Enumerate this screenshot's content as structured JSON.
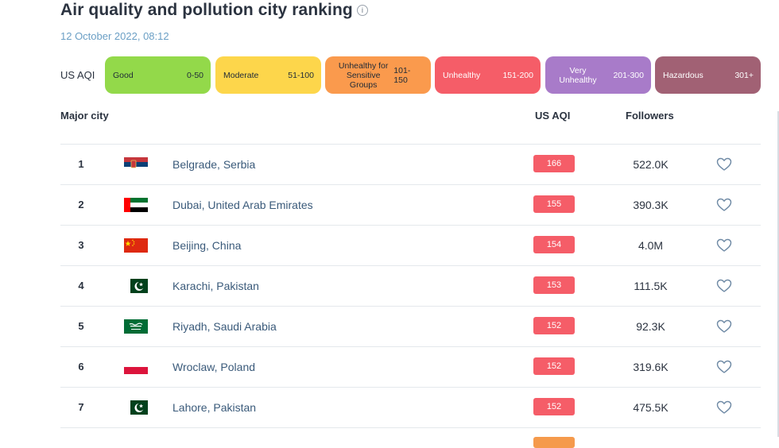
{
  "header": {
    "title": "Air quality and pollution city ranking",
    "info_icon": "info-icon",
    "info_glyph": "i",
    "timestamp": "12 October 2022, 08:12"
  },
  "legend": {
    "label": "US AQI",
    "items": [
      {
        "category": "Good",
        "range": "0-50",
        "color": "#93d94a"
      },
      {
        "category": "Moderate",
        "range": "51-100",
        "color": "#fdd64b"
      },
      {
        "category": "Unhealthy for Sensitive Groups",
        "range": "101-150",
        "color": "#fa9a4d"
      },
      {
        "category": "Unhealthy",
        "range": "151-200",
        "color": "#f55d68"
      },
      {
        "category": "Very Unhealthy",
        "range": "201-300",
        "color": "#a87bc9"
      },
      {
        "category": "Hazardous",
        "range": "301+",
        "color": "#a16174"
      }
    ]
  },
  "table": {
    "columns": {
      "city": "Major city",
      "aqi": "US AQI",
      "followers": "Followers"
    },
    "rows": [
      {
        "rank": "1",
        "flag": "serbia-flag",
        "city": "Belgrade, Serbia",
        "aqi": "166",
        "followers": "522.0K"
      },
      {
        "rank": "2",
        "flag": "uae-flag",
        "city": "Dubai, United Arab Emirates",
        "aqi": "155",
        "followers": "390.3K"
      },
      {
        "rank": "3",
        "flag": "china-flag",
        "city": "Beijing, China",
        "aqi": "154",
        "followers": "4.0M"
      },
      {
        "rank": "4",
        "flag": "pakistan-flag",
        "city": "Karachi, Pakistan",
        "aqi": "153",
        "followers": "111.5K"
      },
      {
        "rank": "5",
        "flag": "saudi-arabia-flag",
        "city": "Riyadh, Saudi Arabia",
        "aqi": "152",
        "followers": "92.3K"
      },
      {
        "rank": "6",
        "flag": "poland-flag",
        "city": "Wroclaw, Poland",
        "aqi": "152",
        "followers": "319.6K"
      },
      {
        "rank": "7",
        "flag": "pakistan-flag",
        "city": "Lahore, Pakistan",
        "aqi": "152",
        "followers": "475.5K"
      }
    ],
    "aqi_color": "#f55d68",
    "follow_icon": "heart-icon"
  }
}
